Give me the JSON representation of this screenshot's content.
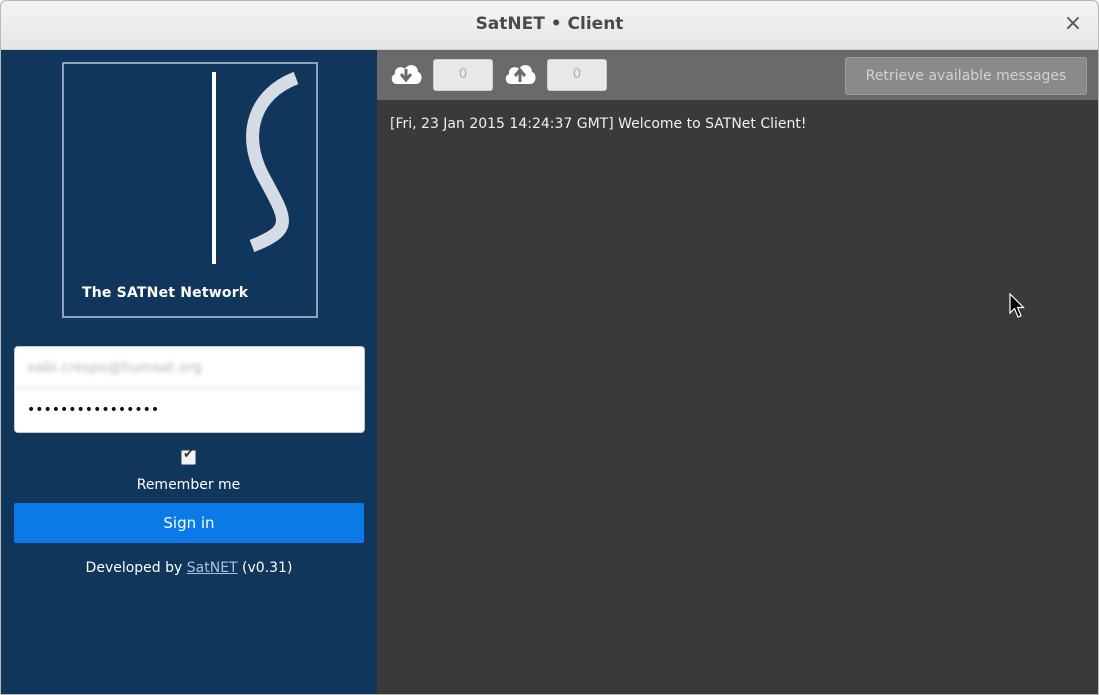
{
  "window": {
    "title": "SatNET • Client",
    "close_glyph": "×"
  },
  "sidebar": {
    "logo": {
      "caption": "The SATNet Network",
      "icon": "satnet-logo"
    },
    "login": {
      "email_value": "xabi.crespo@humsat.org",
      "password_value": "••••••••••••••••"
    },
    "remember_me": {
      "label": "Remember me",
      "checked": true
    },
    "sign_in_label": "Sign in",
    "footer": {
      "prefix": "Developed by ",
      "link_text": "SatNET",
      "suffix": " (v0.31)"
    }
  },
  "main": {
    "toolbar": {
      "download_icon": "cloud-download-icon",
      "download_count": "0",
      "upload_icon": "cloud-upload-icon",
      "upload_count": "0",
      "retrieve_label": "Retrieve available messages"
    },
    "log_lines": [
      "[Fri, 23 Jan 2015 14:24:37 GMT] Welcome to SATNet Client!"
    ]
  },
  "colors": {
    "sidebar_bg": "#11365c",
    "main_bg": "#3a3a3a",
    "toolbar_bg": "#6a6a6a",
    "sign_in_bg": "#0a7ae6"
  }
}
